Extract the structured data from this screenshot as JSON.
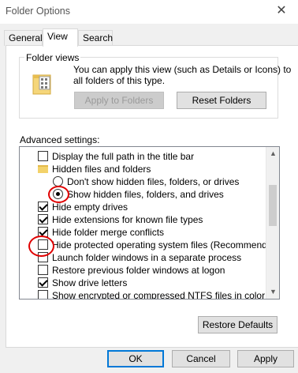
{
  "window": {
    "title": "Folder Options",
    "close_glyph": "✕"
  },
  "tabs": [
    {
      "label": "General",
      "active": false
    },
    {
      "label": "View",
      "active": true
    },
    {
      "label": "Search",
      "active": false
    }
  ],
  "folder_views": {
    "label": "Folder views",
    "description_line1": "You can apply this view (such as Details or Icons) to",
    "description_line2": "all folders of this type.",
    "apply_label": "Apply to Folders",
    "reset_label": "Reset Folders"
  },
  "advanced": {
    "label": "Advanced settings:",
    "items": [
      {
        "type": "checkbox",
        "checked": false,
        "label": "Display the full path in the title bar"
      },
      {
        "type": "folder",
        "label": "Hidden files and folders"
      },
      {
        "type": "radio",
        "checked": false,
        "label": "Don't show hidden files, folders, or drives"
      },
      {
        "type": "radio",
        "checked": true,
        "label": "Show hidden files, folders, and drives"
      },
      {
        "type": "checkbox",
        "checked": true,
        "label": "Hide empty drives"
      },
      {
        "type": "checkbox",
        "checked": true,
        "label": "Hide extensions for known file types"
      },
      {
        "type": "checkbox",
        "checked": true,
        "label": "Hide folder merge conflicts"
      },
      {
        "type": "checkbox",
        "checked": false,
        "label": "Hide protected operating system files (Recommended)"
      },
      {
        "type": "checkbox",
        "checked": false,
        "label": "Launch folder windows in a separate process"
      },
      {
        "type": "checkbox",
        "checked": false,
        "label": "Restore previous folder windows at logon"
      },
      {
        "type": "checkbox",
        "checked": true,
        "label": "Show drive letters"
      },
      {
        "type": "checkbox",
        "checked": false,
        "label": "Show encrypted or compressed NTFS files in color"
      }
    ]
  },
  "restore_defaults_label": "Restore Defaults",
  "footer": {
    "ok": "OK",
    "cancel": "Cancel",
    "apply": "Apply"
  },
  "colors": {
    "annotation": "#e00000",
    "accent": "#0078d7",
    "folder": "#f3d26a"
  },
  "icons": {
    "folder_views": "folder-grid-icon",
    "tree_folder": "folder-icon",
    "scroll_up": "▲",
    "scroll_down": "▼"
  }
}
